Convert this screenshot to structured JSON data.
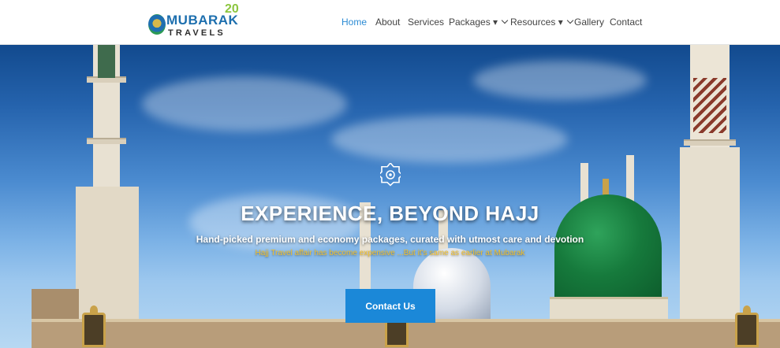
{
  "brand": {
    "name": "MUBARAK",
    "tagline": "TRAVELS",
    "anniversary": "20"
  },
  "nav": {
    "items": [
      {
        "label": "Home",
        "active": true
      },
      {
        "label": "About"
      },
      {
        "label": "Services"
      },
      {
        "label": "Packages ▾"
      },
      {
        "label": "Resources ▾"
      },
      {
        "label": "Gallery"
      },
      {
        "label": "Contact"
      }
    ]
  },
  "hero": {
    "icon": "octagram-emblem-icon",
    "title": "EXPERIENCE, BEYOND HAJJ",
    "subtitle": "Hand-picked premium and economy packages, curated with utmost care and devotion",
    "note": "Hajj Travel affair has become expensive ...But it's same as earlier at Mubarak",
    "cta_label": "Contact Us"
  },
  "colors": {
    "accent": "#2b8bd4",
    "cta": "#1b88d8",
    "note": "#f2c12e"
  }
}
